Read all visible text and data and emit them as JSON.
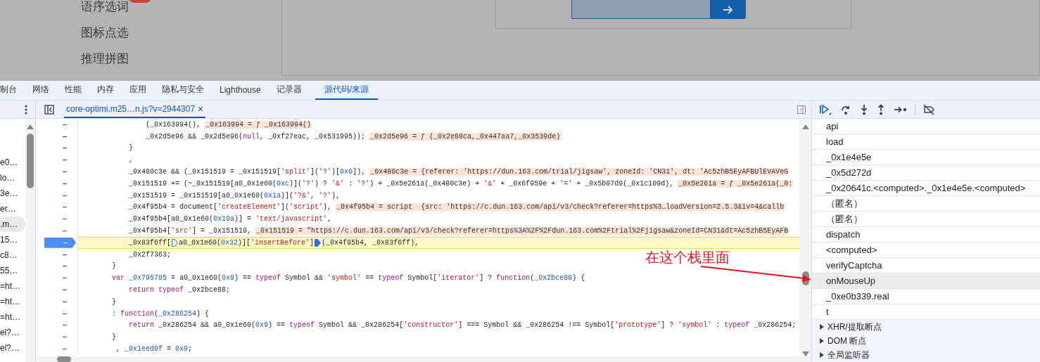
{
  "page": {
    "menu": [
      {
        "label": "语序选词",
        "badge": true
      },
      {
        "label": "图标点选",
        "badge": false
      },
      {
        "label": "推理拼图",
        "badge": false
      }
    ]
  },
  "tabs": [
    {
      "label": "制台",
      "selected": false
    },
    {
      "label": "网络",
      "selected": false
    },
    {
      "label": "性能",
      "selected": false
    },
    {
      "label": "内存",
      "selected": false
    },
    {
      "label": "应用",
      "selected": false
    },
    {
      "label": "隐私与安全",
      "selected": false
    },
    {
      "label": "Lighthouse",
      "selected": false
    },
    {
      "label": "记录器",
      "selected": false
    },
    {
      "label": "源代码/来源",
      "selected": true
    }
  ],
  "navigator": {
    "files": [
      {
        "label": "e0…",
        "selected": false
      },
      {
        "label": "lo…",
        "selected": false
      },
      {
        "label": "3e…",
        "selected": false
      },
      {
        "label": "er…",
        "selected": false
      },
      {
        "label": ".m…",
        "selected": true
      },
      {
        "label": "15…",
        "selected": false
      },
      {
        "label": "c8…",
        "selected": false
      },
      {
        "label": "55…",
        "selected": false
      },
      {
        "label": "=ht…",
        "selected": false
      },
      {
        "label": "=ht…",
        "selected": false
      },
      {
        "label": "=ht…",
        "selected": false
      },
      {
        "label": "el?…",
        "selected": false
      },
      {
        "label": "el?…",
        "selected": false
      }
    ]
  },
  "editor": {
    "file_tab": {
      "label": "core-optimi.m25…n.js?v=2944307",
      "close": "×"
    },
    "lines": [
      {
        "code": [
          "                (_0x163994(),"
        ],
        "hint": "_0x163994 = ƒ _0x163994()",
        "current": false
      },
      {
        "code": [
          "                _0x2d5e96 && _0x2d5e96(",
          {
            "text": "null",
            "kind": "keyword"
          },
          ", _0xf27eac, _0x531995));"
        ],
        "hint": "_0x2d5e96 = ƒ (_0x2e88ca,_0x447aa7,_0x3539de)",
        "current": false
      },
      {
        "code": [
          "            }"
        ],
        "current": false
      },
      {
        "code": [
          "            ,"
        ],
        "current": false
      },
      {
        "code": [
          "            _0x480c3e && (_0x151519 = _0x151519[",
          {
            "text": "'split'",
            "kind": "string"
          },
          "](",
          {
            "text": "'?'",
            "kind": "string"
          },
          ")[",
          {
            "text": "0x0",
            "kind": "number"
          },
          "]),"
        ],
        "hint": "_0x480c3e = {referer: 'https://dun.163.com/trial/jigsaw', zoneId: 'CN31', dt: 'Ac5zhB5EyAFBUlEVAVeG",
        "current": false
      },
      {
        "code": [
          "            _0x151519 += (~_0x151519[a0_0x1e60(",
          {
            "text": "0xc",
            "kind": "number"
          },
          ")](",
          {
            "text": "'?'",
            "kind": "string"
          },
          ") ? ",
          {
            "text": "'&'",
            "kind": "string"
          },
          " : ",
          {
            "text": "'?'",
            "kind": "string"
          },
          ") + _0x5e261a(_0x480c3e) + ",
          {
            "text": "'&'",
            "kind": "string"
          },
          " + _0x6f959e + ",
          {
            "text": "'='",
            "kind": "string"
          },
          " + _0x5b07d9(_0x1c109d),"
        ],
        "hint": "_0x5e261a = ƒ _0x5e261a(_0:",
        "current": false
      },
      {
        "code": [
          "            _0x151519 = _0x151519[a0_0x1e60(",
          {
            "text": "0x1a",
            "kind": "number"
          },
          ")](",
          {
            "text": "'?&'",
            "kind": "string"
          },
          ", ",
          {
            "text": "'?'",
            "kind": "string"
          },
          "),"
        ],
        "current": false
      },
      {
        "code": [
          "            _0x4f95b4 = document[",
          {
            "text": "'createElement'",
            "kind": "string"
          },
          "](",
          {
            "text": "'script'",
            "kind": "string"
          },
          "),"
        ],
        "hint": "_0x4f95b4 = script  {src: 'https://c.dun.163.com/api/v3/check?referer=https%3…loadVersion=2.5.3&iv=4&callb",
        "current": false
      },
      {
        "code": [
          "            _0x4f95b4[a0_0x1e60(",
          {
            "text": "0x10a",
            "kind": "number"
          },
          ")] = ",
          {
            "text": "'text/javascript'",
            "kind": "string"
          },
          ","
        ],
        "current": false
      },
      {
        "code": [
          "            _0x4f95b4[",
          {
            "text": "'src'",
            "kind": "string"
          },
          "] = _0x151519,"
        ],
        "hint": "_0x151519 = \"https://c.dun.163.com/api/v3/check?referer=https%3A%2F%2Fdun.163.com%2Ftrial%2Fjigsaw&zoneId=CN31&dt=Ac5zhB5EyAFB",
        "current": false
      },
      {
        "code": [
          "            _0x83f6ff[",
          {
            "kind": "marker",
            "filled": false
          },
          "a0_0x1e60(",
          {
            "text": "0x32",
            "kind": "number"
          },
          ")][",
          {
            "text": "'insertBefore'",
            "kind": "string"
          },
          "]",
          {
            "kind": "marker",
            "filled": true
          },
          "(_0x4f95b4, _0x83f6ff),"
        ],
        "current": true
      },
      {
        "code": [
          "            _0x2f7363;"
        ],
        "current": false
      },
      {
        "code": [
          "        }"
        ],
        "current": false
      },
      {
        "code": [
          {
            "text": "        var ",
            "kind": "keyword"
          },
          {
            "text": "_0x795785",
            "kind": "def"
          },
          " = a0_0x1e60(",
          {
            "text": "0x9",
            "kind": "number"
          },
          ") == ",
          {
            "text": "typeof",
            "kind": "keyword"
          },
          " Symbol && ",
          {
            "text": "'symbol'",
            "kind": "string"
          },
          " == ",
          {
            "text": "typeof",
            "kind": "keyword"
          },
          " Symbol[",
          {
            "text": "'iterator'",
            "kind": "string"
          },
          "] ? ",
          {
            "text": "function",
            "kind": "keyword"
          },
          "(",
          {
            "text": "_0x2bce88",
            "kind": "def"
          },
          ") {"
        ],
        "current": false
      },
      {
        "code": [
          {
            "text": "            return typeof",
            "kind": "keyword"
          },
          " _0x2bce88;"
        ],
        "current": false
      },
      {
        "code": [
          "        }"
        ],
        "current": false
      },
      {
        "code": [
          "        : ",
          {
            "text": "function",
            "kind": "keyword"
          },
          "(",
          {
            "text": "_0x286254",
            "kind": "def"
          },
          ") {"
        ],
        "current": false
      },
      {
        "code": [
          {
            "text": "            return",
            "kind": "keyword"
          },
          " _0x286254 && a0_0x1e60(",
          {
            "text": "0x9",
            "kind": "number"
          },
          ") == ",
          {
            "text": "typeof",
            "kind": "keyword"
          },
          " Symbol && _0x286254[",
          {
            "text": "'constructor'",
            "kind": "string"
          },
          "] === Symbol && _0x286254 !== Symbol[",
          {
            "text": "'prototype'",
            "kind": "string"
          },
          "] ? ",
          {
            "text": "'symbol'",
            "kind": "string"
          },
          " : ",
          {
            "text": "typeof",
            "kind": "keyword"
          },
          " _0x286254;"
        ],
        "current": false
      },
      {
        "code": [
          "        }"
        ],
        "current": false
      },
      {
        "code": [
          "         , ",
          {
            "text": "_0x1eed0f",
            "kind": "def"
          },
          " = ",
          {
            "text": "0x0",
            "kind": "number"
          },
          ";"
        ],
        "current": false
      }
    ]
  },
  "debugger": {
    "call_stack": [
      {
        "label": "api",
        "selected": false
      },
      {
        "label": "load",
        "selected": false
      },
      {
        "label": "_0x1e4e5e",
        "selected": false
      },
      {
        "label": "_0x5d272d",
        "selected": false
      },
      {
        "label": "_0x20641c.<computed>._0x1e4e5e.<computed>",
        "selected": false
      },
      {
        "label": "（匿名）",
        "selected": false
      },
      {
        "label": "（匿名）",
        "selected": false
      },
      {
        "label": "dispatch",
        "selected": false
      },
      {
        "label": "<computed>",
        "selected": false
      },
      {
        "label": "verifyCaptcha",
        "selected": false
      },
      {
        "label": "onMouseUp",
        "selected": true
      },
      {
        "label": "_0xe0b339.real",
        "selected": false
      },
      {
        "label": "t",
        "selected": false
      }
    ],
    "sections": [
      {
        "label": "XHR/提取断点",
        "expanded": false
      },
      {
        "label": "DOM 断点",
        "expanded": false
      },
      {
        "label": "全局监听器",
        "expanded": false
      }
    ]
  },
  "annotation": {
    "text": "在这个栈里面"
  }
}
